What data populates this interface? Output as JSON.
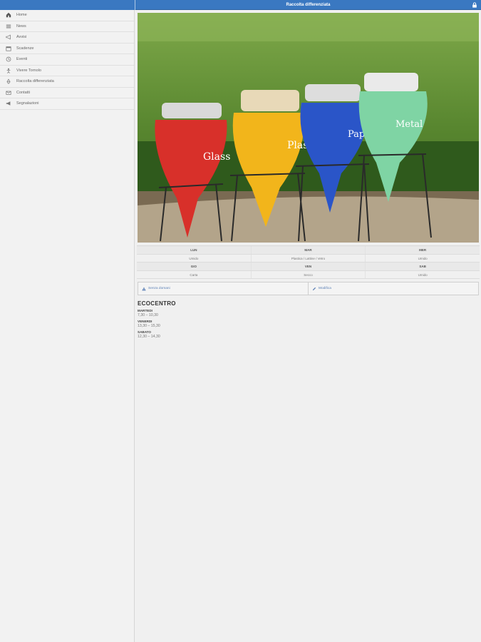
{
  "header": {
    "title": "Raccolta differenziata"
  },
  "sidebar": {
    "items": [
      {
        "label": "Home",
        "icon": "home-icon"
      },
      {
        "label": "News",
        "icon": "news-icon"
      },
      {
        "label": "Avvisi",
        "icon": "megaphone-icon"
      },
      {
        "label": "Scadenze",
        "icon": "calendar-icon"
      },
      {
        "label": "Eventi",
        "icon": "events-icon"
      },
      {
        "label": "Vivere Tornolo",
        "icon": "person-icon"
      },
      {
        "label": "Raccolta differenziata",
        "icon": "recycle-icon"
      },
      {
        "label": "Contatti",
        "icon": "mail-icon"
      },
      {
        "label": "Segnalazioni",
        "icon": "report-megaphone-icon"
      }
    ]
  },
  "photo": {
    "bins": [
      {
        "label": "Glass",
        "color": "#d8302a"
      },
      {
        "label": "Plastic",
        "color": "#f2b51b"
      },
      {
        "label": "Paper",
        "color": "#2a55c8"
      },
      {
        "label": "Metal",
        "color": "#7fd4a4"
      }
    ]
  },
  "schedule": {
    "rows": [
      {
        "head": true,
        "cells": [
          "LUN",
          "MAR",
          "MER"
        ]
      },
      {
        "head": false,
        "cells": [
          "Umido",
          "Plastica / Lattine / Vetro",
          "Umido"
        ]
      },
      {
        "head": true,
        "cells": [
          "GIO",
          "VEN",
          "SAB"
        ]
      },
      {
        "head": false,
        "cells": [
          "Carta",
          "Secco",
          "Umido"
        ]
      }
    ]
  },
  "actions": {
    "warning_label": "Senza domani",
    "edit_label": "Modifica"
  },
  "ecocentro": {
    "name": "ECOCENTRO",
    "entries": [
      {
        "day": "MARTEDI",
        "hours": "7,30 – 10,30"
      },
      {
        "day": "VENERDI",
        "hours": "13,30 – 15,30"
      },
      {
        "day": "SABATO",
        "hours": "12,30 – 14,30"
      }
    ]
  },
  "colors": {
    "accent": "#3a78c1"
  }
}
